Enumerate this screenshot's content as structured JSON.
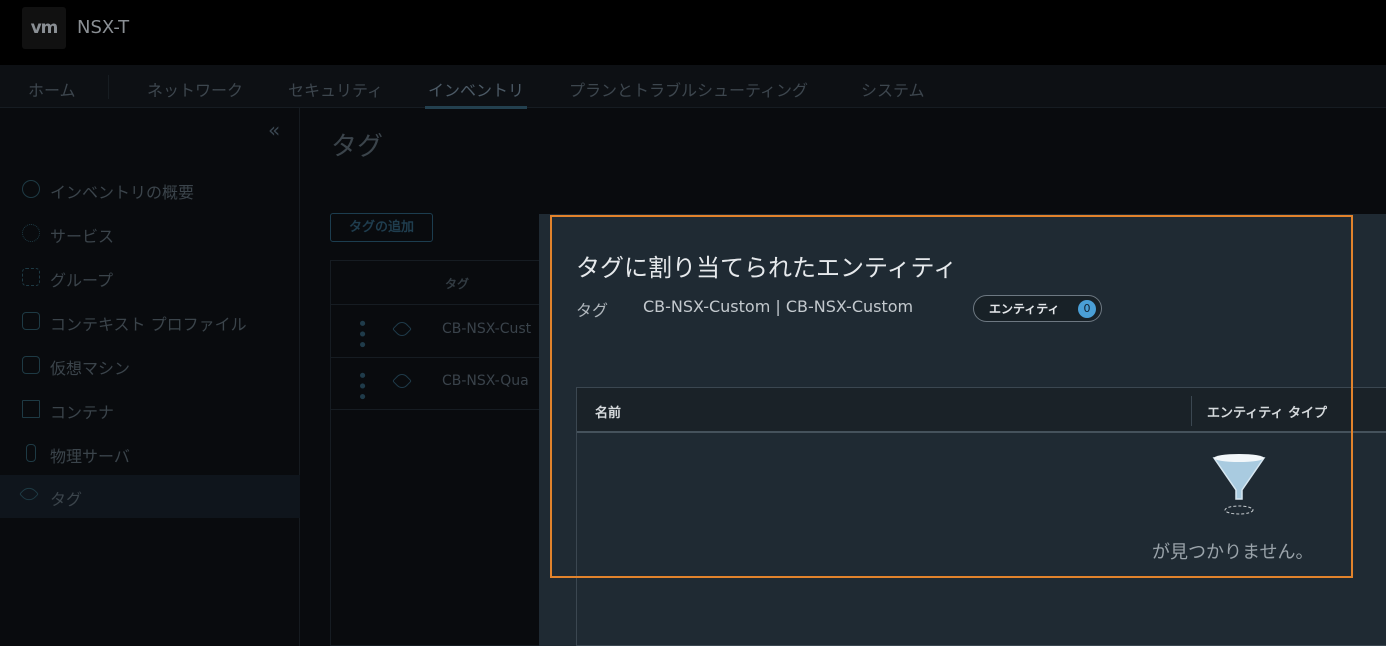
{
  "header": {
    "logo": "vm",
    "app_title": "NSX-T"
  },
  "nav": {
    "items": [
      "ホーム",
      "ネットワーク",
      "セキュリティ",
      "インベントリ",
      "プランとトラブルシューティング",
      "システム"
    ],
    "active": "インベントリ"
  },
  "sidebar": {
    "items": [
      {
        "label": "インベントリの概要",
        "icon": "dashboard-icon"
      },
      {
        "label": "サービス",
        "icon": "gear-icon"
      },
      {
        "label": "グループ",
        "icon": "group-icon"
      },
      {
        "label": "コンテキスト プロファイル",
        "icon": "profile-icon"
      },
      {
        "label": "仮想マシン",
        "icon": "vm-icon"
      },
      {
        "label": "コンテナ",
        "icon": "container-icon"
      },
      {
        "label": "物理サーバ",
        "icon": "server-icon"
      },
      {
        "label": "タグ",
        "icon": "tag-icon"
      }
    ],
    "active": "タグ"
  },
  "main": {
    "title": "タグ",
    "add_button": "タグの追加",
    "table": {
      "header": "タグ",
      "rows": [
        "CB-NSX-Cust",
        "CB-NSX-Qua"
      ]
    }
  },
  "panel": {
    "title": "タグに割り当てられたエンティティ",
    "tag_label": "タグ",
    "tag_value": "CB-NSX-Custom | CB-NSX-Custom",
    "badge_label": "エンティティ",
    "badge_count": "0",
    "table": {
      "columns": [
        "名前",
        "エンティティ タイプ"
      ],
      "empty_text": "が見つかりません。"
    }
  },
  "colors": {
    "highlight": "#e2832c",
    "badge": "#4a9fd6"
  }
}
